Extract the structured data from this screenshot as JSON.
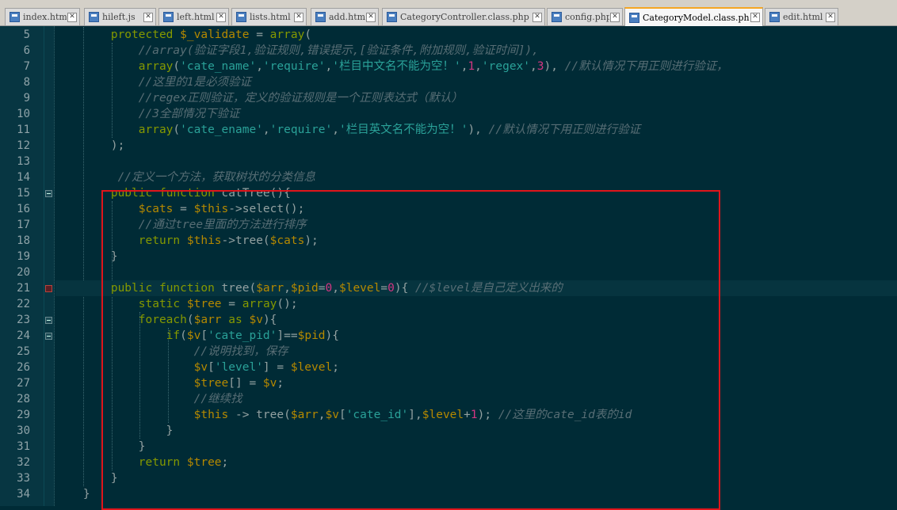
{
  "tabs": [
    {
      "label": "index.html",
      "close": "✕"
    },
    {
      "label": "hileft.js",
      "close": "✕"
    },
    {
      "label": "left.html",
      "close": "✕"
    },
    {
      "label": "lists.html",
      "close": "✕"
    },
    {
      "label": "add.html",
      "close": "✕"
    },
    {
      "label": "CategoryController.class.php",
      "close": "✕"
    },
    {
      "label": "config.php",
      "close": "✕"
    },
    {
      "label": "CategoryModel.class.php",
      "close": "✕",
      "active": true
    },
    {
      "label": "edit.html",
      "close": "✕"
    }
  ],
  "editor": {
    "theme_colors": {
      "background": "#002b36",
      "keyword": "#859900",
      "variable": "#b58900",
      "string": "#2aa198",
      "comment": "#586e75",
      "number": "#d33682",
      "highlight_box": "#e0151b"
    },
    "lines": [
      {
        "n": "5",
        "tokens": [
          [
            "",
            "        "
          ],
          [
            "kw",
            "protected"
          ],
          [
            "",
            " "
          ],
          [
            "var",
            "$_validate"
          ],
          [
            "",
            " = "
          ],
          [
            "kw",
            "array"
          ],
          [
            "",
            "("
          ]
        ]
      },
      {
        "n": "6",
        "tokens": [
          [
            "",
            "            "
          ],
          [
            "cmt",
            "//array(验证字段1,验证规则,错误提示,[验证条件,附加规则,验证时间]),"
          ]
        ]
      },
      {
        "n": "7",
        "tokens": [
          [
            "",
            "            "
          ],
          [
            "kw",
            "array"
          ],
          [
            "",
            "("
          ],
          [
            "str",
            "'cate_name'"
          ],
          [
            "",
            ","
          ],
          [
            "str",
            "'require'"
          ],
          [
            "",
            ","
          ],
          [
            "str",
            "'栏目中文名不能为空！'"
          ],
          [
            "",
            ","
          ],
          [
            "num",
            "1"
          ],
          [
            "",
            ","
          ],
          [
            "str",
            "'regex'"
          ],
          [
            "",
            ","
          ],
          [
            "num",
            "3"
          ],
          [
            "",
            "), "
          ],
          [
            "cmt",
            "//默认情况下用正则进行验证，"
          ]
        ]
      },
      {
        "n": "8",
        "tokens": [
          [
            "",
            "            "
          ],
          [
            "cmt",
            "//这里的1是必须验证"
          ]
        ]
      },
      {
        "n": "9",
        "tokens": [
          [
            "",
            "            "
          ],
          [
            "cmt",
            "//regex正则验证，定义的验证规则是一个正则表达式（默认）"
          ]
        ]
      },
      {
        "n": "10",
        "tokens": [
          [
            "",
            "            "
          ],
          [
            "cmt",
            "//3全部情况下验证"
          ]
        ]
      },
      {
        "n": "11",
        "tokens": [
          [
            "",
            "            "
          ],
          [
            "kw",
            "array"
          ],
          [
            "",
            "("
          ],
          [
            "str",
            "'cate_ename'"
          ],
          [
            "",
            ","
          ],
          [
            "str",
            "'require'"
          ],
          [
            "",
            ","
          ],
          [
            "str",
            "'栏目英文名不能为空！'"
          ],
          [
            "",
            "), "
          ],
          [
            "cmt",
            "//默认情况下用正则进行验证"
          ]
        ]
      },
      {
        "n": "12",
        "tokens": [
          [
            "",
            "        );"
          ]
        ]
      },
      {
        "n": "13",
        "tokens": [
          [
            "",
            ""
          ]
        ]
      },
      {
        "n": "14",
        "tokens": [
          [
            "",
            "         "
          ],
          [
            "cmt",
            "//定义一个方法，获取树状的分类信息"
          ]
        ]
      },
      {
        "n": "15",
        "tokens": [
          [
            "",
            "        "
          ],
          [
            "kw",
            "public"
          ],
          [
            "",
            " "
          ],
          [
            "kw",
            "function"
          ],
          [
            "",
            " catTree(){"
          ]
        ]
      },
      {
        "n": "16",
        "tokens": [
          [
            "",
            "            "
          ],
          [
            "var",
            "$cats"
          ],
          [
            "",
            " = "
          ],
          [
            "var",
            "$this"
          ],
          [
            "",
            "->select();"
          ]
        ]
      },
      {
        "n": "17",
        "tokens": [
          [
            "",
            "            "
          ],
          [
            "cmt",
            "//通过tree里面的方法进行排序"
          ]
        ]
      },
      {
        "n": "18",
        "tokens": [
          [
            "",
            "            "
          ],
          [
            "kw",
            "return"
          ],
          [
            "",
            " "
          ],
          [
            "var",
            "$this"
          ],
          [
            "",
            "->tree("
          ],
          [
            "var",
            "$cats"
          ],
          [
            "",
            ");"
          ]
        ]
      },
      {
        "n": "19",
        "tokens": [
          [
            "",
            "        }"
          ]
        ]
      },
      {
        "n": "20",
        "tokens": [
          [
            "",
            ""
          ]
        ]
      },
      {
        "n": "21",
        "tokens": [
          [
            "",
            "        "
          ],
          [
            "kw",
            "public"
          ],
          [
            "",
            " "
          ],
          [
            "kw",
            "function"
          ],
          [
            "",
            " tree("
          ],
          [
            "var",
            "$arr"
          ],
          [
            "",
            ","
          ],
          [
            "var",
            "$pid"
          ],
          [
            "",
            "="
          ],
          [
            "num",
            "0"
          ],
          [
            "",
            ","
          ],
          [
            "var",
            "$level"
          ],
          [
            "",
            "="
          ],
          [
            "num",
            "0"
          ],
          [
            "",
            "){ "
          ],
          [
            "cmt",
            "//$level是自己定义出来的"
          ]
        ]
      },
      {
        "n": "22",
        "tokens": [
          [
            "",
            "            "
          ],
          [
            "kw",
            "static"
          ],
          [
            "",
            " "
          ],
          [
            "var",
            "$tree"
          ],
          [
            "",
            " = "
          ],
          [
            "kw",
            "array"
          ],
          [
            "",
            "();"
          ]
        ]
      },
      {
        "n": "23",
        "tokens": [
          [
            "",
            "            "
          ],
          [
            "kw",
            "foreach"
          ],
          [
            "",
            "("
          ],
          [
            "var",
            "$arr"
          ],
          [
            "",
            " "
          ],
          [
            "kw",
            "as"
          ],
          [
            "",
            " "
          ],
          [
            "var",
            "$v"
          ],
          [
            "",
            "){"
          ]
        ]
      },
      {
        "n": "24",
        "tokens": [
          [
            "",
            "                "
          ],
          [
            "kw",
            "if"
          ],
          [
            "",
            "("
          ],
          [
            "var",
            "$v"
          ],
          [
            "",
            "["
          ],
          [
            "str",
            "'cate_pid'"
          ],
          [
            "",
            "]=="
          ],
          [
            "var",
            "$pid"
          ],
          [
            "",
            "){"
          ]
        ]
      },
      {
        "n": "25",
        "tokens": [
          [
            "",
            "                    "
          ],
          [
            "cmt",
            "//说明找到，保存"
          ]
        ]
      },
      {
        "n": "26",
        "tokens": [
          [
            "",
            "                    "
          ],
          [
            "var",
            "$v"
          ],
          [
            "",
            "["
          ],
          [
            "str",
            "'level'"
          ],
          [
            "",
            "] = "
          ],
          [
            "var",
            "$level"
          ],
          [
            "",
            ";"
          ]
        ]
      },
      {
        "n": "27",
        "tokens": [
          [
            "",
            "                    "
          ],
          [
            "var",
            "$tree"
          ],
          [
            "",
            "[] = "
          ],
          [
            "var",
            "$v"
          ],
          [
            "",
            ";"
          ]
        ]
      },
      {
        "n": "28",
        "tokens": [
          [
            "",
            "                    "
          ],
          [
            "cmt",
            "//继续找"
          ]
        ]
      },
      {
        "n": "29",
        "tokens": [
          [
            "",
            "                    "
          ],
          [
            "var",
            "$this"
          ],
          [
            "",
            " -> tree("
          ],
          [
            "var",
            "$arr"
          ],
          [
            "",
            ","
          ],
          [
            "var",
            "$v"
          ],
          [
            "",
            "["
          ],
          [
            "str",
            "'cate_id'"
          ],
          [
            "",
            "],"
          ],
          [
            "var",
            "$level"
          ],
          [
            "",
            "+"
          ],
          [
            "num",
            "1"
          ],
          [
            "",
            "); "
          ],
          [
            "cmt",
            "//这里的cate_id表的id"
          ]
        ]
      },
      {
        "n": "30",
        "tokens": [
          [
            "",
            "                }"
          ]
        ]
      },
      {
        "n": "31",
        "tokens": [
          [
            "",
            "            }"
          ]
        ]
      },
      {
        "n": "32",
        "tokens": [
          [
            "",
            "            "
          ],
          [
            "kw",
            "return"
          ],
          [
            "",
            " "
          ],
          [
            "var",
            "$tree"
          ],
          [
            "",
            ";"
          ]
        ]
      },
      {
        "n": "33",
        "tokens": [
          [
            "",
            "        }"
          ]
        ]
      },
      {
        "n": "34",
        "tokens": [
          [
            "",
            "    }"
          ]
        ]
      }
    ],
    "current_line": "21",
    "fold_markers": [
      "15",
      "23",
      "24"
    ],
    "bookmarks": [
      "21"
    ]
  }
}
